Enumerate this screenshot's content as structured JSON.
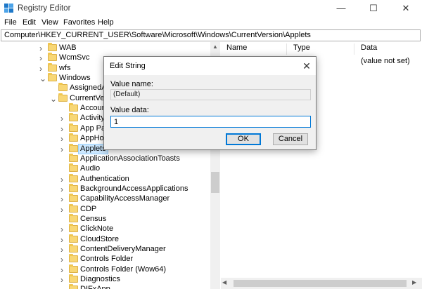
{
  "window": {
    "title": "Registry Editor",
    "controls": {
      "minimize": "—",
      "maximize": "☐",
      "close": "✕"
    }
  },
  "menu": [
    "File",
    "Edit",
    "View",
    "Favorites",
    "Help"
  ],
  "address": "Computer\\HKEY_CURRENT_USER\\Software\\Microsoft\\Windows\\CurrentVersion\\Applets",
  "tree": {
    "items": [
      {
        "label": "WAB",
        "expander": ">"
      },
      {
        "label": "WcmSvc",
        "expander": ">"
      },
      {
        "label": "wfs",
        "expander": ">"
      },
      {
        "label": "Windows",
        "expander": "v"
      },
      {
        "label": "AssignedAc",
        "expander": ""
      },
      {
        "label": "CurrentVersi",
        "expander": "v"
      },
      {
        "label": "AccountS",
        "expander": ""
      },
      {
        "label": "ActivityD",
        "expander": ">"
      },
      {
        "label": "App Path",
        "expander": ">"
      },
      {
        "label": "AppHost",
        "expander": ">"
      },
      {
        "label": "Applets",
        "expander": ">",
        "selected": true
      },
      {
        "label": "ApplicationAssociationToasts",
        "expander": ""
      },
      {
        "label": "Audio",
        "expander": ""
      },
      {
        "label": "Authentication",
        "expander": ">"
      },
      {
        "label": "BackgroundAccessApplications",
        "expander": ">"
      },
      {
        "label": "CapabilityAccessManager",
        "expander": ">"
      },
      {
        "label": "CDP",
        "expander": ">"
      },
      {
        "label": "Census",
        "expander": ""
      },
      {
        "label": "ClickNote",
        "expander": ">"
      },
      {
        "label": "CloudStore",
        "expander": ">"
      },
      {
        "label": "ContentDeliveryManager",
        "expander": ">"
      },
      {
        "label": "Controls Folder",
        "expander": ">"
      },
      {
        "label": "Controls Folder (Wow64)",
        "expander": ">"
      },
      {
        "label": "Diagnostics",
        "expander": ">"
      },
      {
        "label": "DIFxApp",
        "expander": ""
      }
    ]
  },
  "list": {
    "columns": [
      "Name",
      "Type",
      "Data"
    ],
    "rows": [
      {
        "name": "",
        "type": "",
        "data": "(value not set)"
      }
    ]
  },
  "dialog": {
    "title": "Edit String",
    "value_name_label": "Value name:",
    "value_name": "(Default)",
    "value_data_label": "Value data:",
    "value_data": "1",
    "ok": "OK",
    "cancel": "Cancel",
    "close_glyph": "✕"
  },
  "colors": {
    "selection": "#cce8ff",
    "folder": "#f8d775",
    "focus": "#0078d7"
  },
  "icons": [
    "registry-app-icon",
    "folder-icon",
    "chevron-right-icon",
    "chevron-down-icon",
    "close-icon"
  ]
}
